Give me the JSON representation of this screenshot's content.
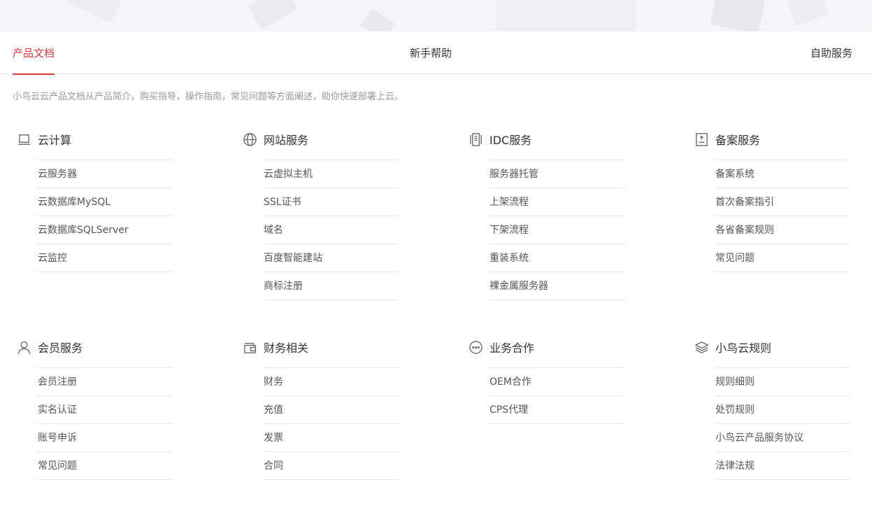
{
  "tabs": [
    {
      "label": "产品文档",
      "active": true
    },
    {
      "label": "新手帮助",
      "active": false
    },
    {
      "label": "自助服务",
      "active": false
    }
  ],
  "intro": "小鸟云云产品文档从产品简介，购买指导，操作指南，常见问题等方面阐述，助你快速部署上云。",
  "accent_color": "#e4393c",
  "groups": [
    {
      "icon": "laptop-icon",
      "title": "云计算",
      "items": [
        "云服务器",
        "云数据库MySQL",
        "云数据库SQLServer",
        "云监控"
      ]
    },
    {
      "icon": "globe-icon",
      "title": "网站服务",
      "items": [
        "云虚拟主机",
        "SSL证书",
        "域名",
        "百度智能建站",
        "商标注册"
      ]
    },
    {
      "icon": "server-rack-icon",
      "title": "IDC服务",
      "items": [
        "服务器托管",
        "上架流程",
        "下架流程",
        "重装系统",
        "裸金属服务器"
      ]
    },
    {
      "icon": "record-document-icon",
      "title": "备案服务",
      "items": [
        "备案系统",
        "首次备案指引",
        "各省备案规则",
        "常见问题"
      ]
    },
    {
      "icon": "user-icon",
      "title": "会员服务",
      "items": [
        "会员注册",
        "实名认证",
        "账号申诉",
        "常见问题"
      ]
    },
    {
      "icon": "wallet-icon",
      "title": "财务相关",
      "items": [
        "财务",
        "充值",
        "发票",
        "合同"
      ]
    },
    {
      "icon": "chat-bubble-icon",
      "title": "业务合作",
      "items": [
        "OEM合作",
        "CPS代理"
      ]
    },
    {
      "icon": "layers-icon",
      "title": "小鸟云规则",
      "items": [
        "规则细则",
        "处罚规则",
        "小鸟云产品服务协议",
        "法律法规"
      ]
    }
  ]
}
